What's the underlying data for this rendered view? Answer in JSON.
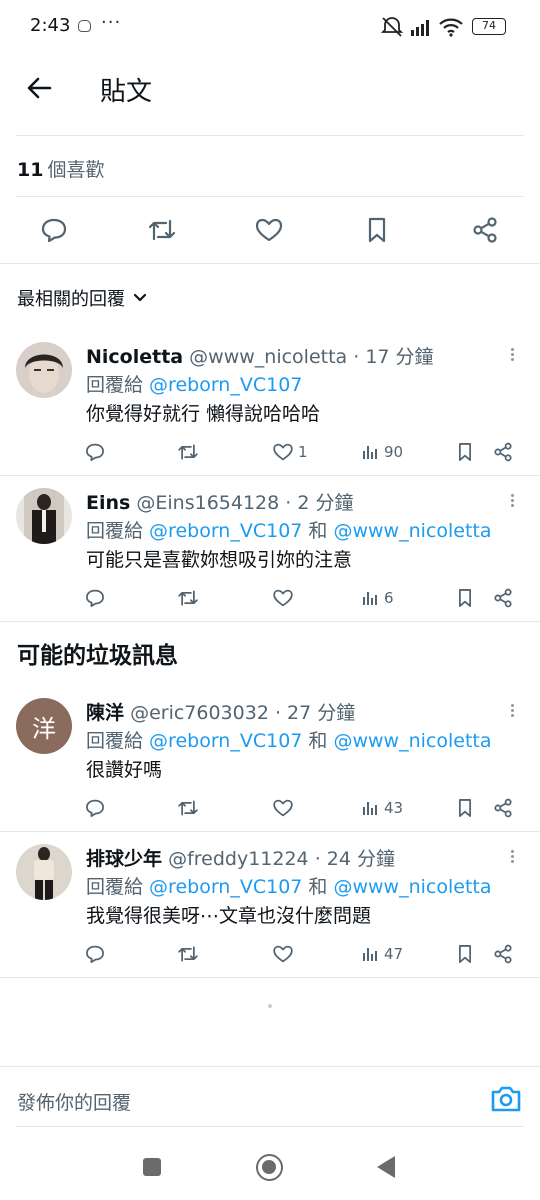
{
  "status_bar": {
    "time": "2:43",
    "dots": "···",
    "battery": "74"
  },
  "header": {
    "title": "貼文"
  },
  "likes": {
    "count": "11",
    "label": "個喜歡"
  },
  "sort": {
    "label": "最相關的回覆"
  },
  "replies": [
    {
      "name": "Nicoletta",
      "handle": "@www_nicoletta",
      "time": "· 17 分鐘",
      "reply_prefix": "回覆給 ",
      "mention1": "@reborn_VC107",
      "joiner": "",
      "mention2": "",
      "text": "你覺得好就行 懶得說哈哈哈",
      "likes": "1",
      "views": "90"
    },
    {
      "name": "Eins",
      "handle": "@Eins1654128",
      "time": "· 2 分鐘",
      "reply_prefix": "回覆給 ",
      "mention1": "@reborn_VC107",
      "joiner": " 和 ",
      "mention2": "@www_nicoletta",
      "text": "可能只是喜歡妳想吸引妳的注意",
      "likes": "",
      "views": "6"
    },
    {
      "name": "陳洋",
      "avatar_letter": "洋",
      "handle": "@eric7603032",
      "time": "· 27 分鐘",
      "reply_prefix": "回覆給 ",
      "mention1": "@reborn_VC107",
      "joiner": " 和 ",
      "mention2": "@www_nicoletta",
      "text": "很讚好嗎",
      "likes": "",
      "views": "43"
    },
    {
      "name": "排球少年",
      "handle": "@freddy11224",
      "time": "· 24 分鐘",
      "reply_prefix": "回覆給 ",
      "mention1": "@reborn_VC107",
      "joiner": " 和 ",
      "mention2": "@www_nicoletta",
      "text": "我覺得很美呀⋯文章也沒什麼問題",
      "likes": "",
      "views": "47"
    }
  ],
  "spam_section": {
    "title": "可能的垃圾訊息"
  },
  "compose": {
    "placeholder": "發佈你的回覆"
  },
  "colors": {
    "accent": "#1d9bf0",
    "muted": "#536471",
    "text": "#0f1419",
    "divider": "#e5e7ea"
  }
}
